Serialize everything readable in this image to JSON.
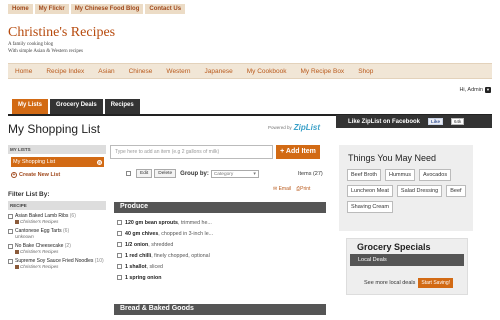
{
  "topnav": [
    "Home",
    "My Flickr",
    "My Chinese Food Blog",
    "Contact Us"
  ],
  "site": {
    "title": "Christine's Recipes",
    "tagline1": "A family cooking blog",
    "tagline2": "With simple Asian & Western recipes"
  },
  "mainnav": [
    "Home",
    "Recipe Index",
    "Asian",
    "Chinese",
    "Western",
    "Japanese",
    "My Cookbook",
    "My Recipe Box",
    "Shop"
  ],
  "user": {
    "greeting": "Hi, Admin"
  },
  "tabs": [
    "My Lists",
    "Grocery Deals",
    "Recipes"
  ],
  "page": {
    "title": "My Shopping List",
    "powered_by": "Powered by",
    "powered_brand": "ZipList"
  },
  "sidebar": {
    "mylists_header": "MY LISTS",
    "active_list": "My Shopping List",
    "create_list": "Create New List",
    "filter_title": "Filter List By:",
    "recipe_header": "RECIPE",
    "recipes": [
      {
        "name": "Asian Baked Lamb Ribs",
        "count": "(6)",
        "source": "Christine's Recipes"
      },
      {
        "name": "Cantonese Egg Tarts",
        "count": "(6)",
        "source": "Unknown"
      },
      {
        "name": "No Bake Cheesecake",
        "count": "(2)",
        "source": "Christine's Recipes"
      },
      {
        "name": "Supreme Soy Sauce Fried Noodles",
        "count": "(10)",
        "source": "Christine's Recipes"
      }
    ]
  },
  "list": {
    "add_placeholder": "Type here to add an item (e.g 2 gallons of milk)",
    "add_button": "+ Add Item",
    "edit": "Edit",
    "delete": "Delete",
    "group_by": "Group by:",
    "group_select": "Category",
    "items_label": "Items (27)",
    "email": "Email",
    "print": "Print",
    "categories": [
      {
        "name": "Produce",
        "entries": [
          {
            "qty": "120 gm bean sprouts",
            "note": ", trimmed he..."
          },
          {
            "qty": "40 gm chives",
            "note": ", chopped in 3-inch le..."
          },
          {
            "qty": "1/2 onion",
            "note": ", shredded"
          },
          {
            "qty": "1 red chilli",
            "note": ", finely chopped, optional"
          },
          {
            "qty": "1 shallot",
            "note": ", sliced"
          },
          {
            "qty": "1 spring onion",
            "note": ""
          }
        ]
      },
      {
        "name": "Bread & Baked Goods",
        "entries": []
      }
    ]
  },
  "right": {
    "ziplist_label": "Like ZipList on Facebook",
    "fb_like": "Like",
    "fb_count": "64k",
    "need_title": "Things You May Need",
    "tags": [
      "Beef Broth",
      "Hummus",
      "Avocados",
      "Luncheon Meat",
      "Salad Dressing",
      "Beef",
      "Shaving Cream"
    ],
    "specials_title": "Grocery Specials",
    "specials_bar": "Local Deals",
    "specials_text": "See more local deals",
    "specials_button": "Start Saving!"
  }
}
